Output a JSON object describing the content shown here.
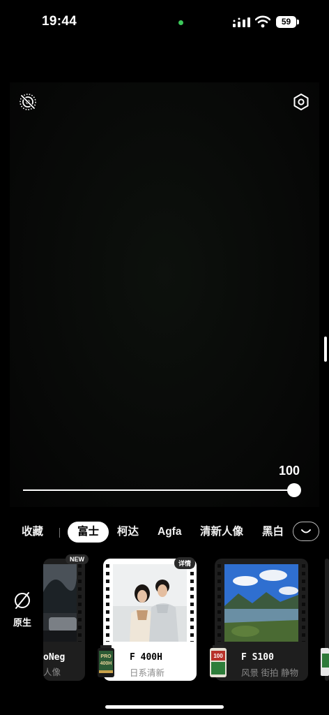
{
  "status": {
    "time": "19:44",
    "battery": "59"
  },
  "viewfinder": {
    "live_icon": "live-photo-off-icon",
    "settings_icon": "settings-hexagon-icon"
  },
  "intensity": {
    "value": "100",
    "fraction": 1.0
  },
  "categories": {
    "items": [
      "收藏",
      "富士",
      "柯达",
      "Agfa",
      "清新人像",
      "黑白"
    ],
    "active": "富士",
    "expand_icon": "chevron-down-icon"
  },
  "native": {
    "label": "原生",
    "icon": "no-filter-icon"
  },
  "films": [
    {
      "name": "oNeg",
      "tags": "人像",
      "badge": "NEW"
    },
    {
      "name": "F 400H",
      "tags": "日系清新",
      "badge": "详情",
      "canister": "PRO 400H"
    },
    {
      "name": "F S100",
      "tags": "风景 街拍 静物",
      "canister": "100"
    }
  ],
  "colors": {
    "accent": "#ffffff",
    "background": "#000000",
    "status_dot": "#3cc85a"
  }
}
